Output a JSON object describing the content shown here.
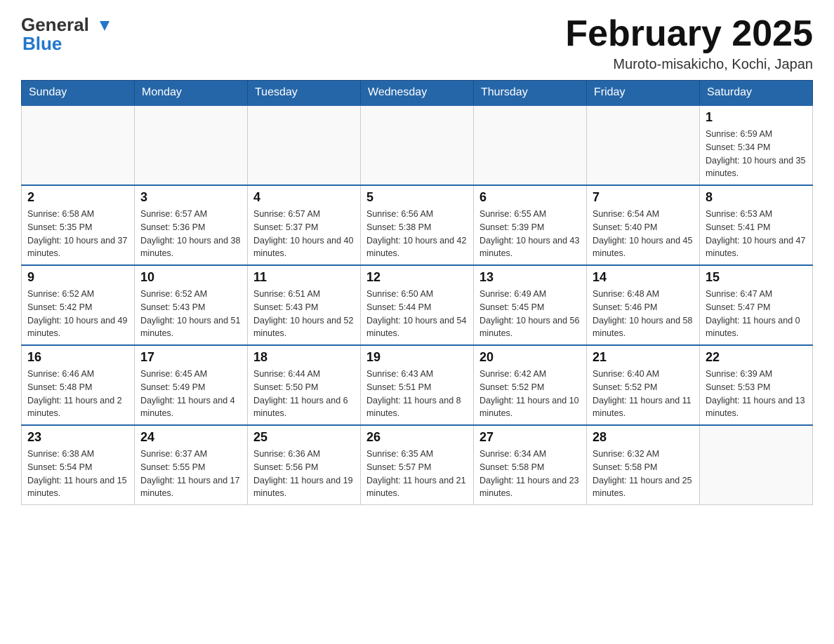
{
  "header": {
    "logo_general": "General",
    "logo_blue": "Blue",
    "month_title": "February 2025",
    "location": "Muroto-misakicho, Kochi, Japan"
  },
  "days_of_week": [
    "Sunday",
    "Monday",
    "Tuesday",
    "Wednesday",
    "Thursday",
    "Friday",
    "Saturday"
  ],
  "weeks": [
    {
      "days": [
        {
          "num": "",
          "info": ""
        },
        {
          "num": "",
          "info": ""
        },
        {
          "num": "",
          "info": ""
        },
        {
          "num": "",
          "info": ""
        },
        {
          "num": "",
          "info": ""
        },
        {
          "num": "",
          "info": ""
        },
        {
          "num": "1",
          "info": "Sunrise: 6:59 AM\nSunset: 5:34 PM\nDaylight: 10 hours and 35 minutes."
        }
      ]
    },
    {
      "days": [
        {
          "num": "2",
          "info": "Sunrise: 6:58 AM\nSunset: 5:35 PM\nDaylight: 10 hours and 37 minutes."
        },
        {
          "num": "3",
          "info": "Sunrise: 6:57 AM\nSunset: 5:36 PM\nDaylight: 10 hours and 38 minutes."
        },
        {
          "num": "4",
          "info": "Sunrise: 6:57 AM\nSunset: 5:37 PM\nDaylight: 10 hours and 40 minutes."
        },
        {
          "num": "5",
          "info": "Sunrise: 6:56 AM\nSunset: 5:38 PM\nDaylight: 10 hours and 42 minutes."
        },
        {
          "num": "6",
          "info": "Sunrise: 6:55 AM\nSunset: 5:39 PM\nDaylight: 10 hours and 43 minutes."
        },
        {
          "num": "7",
          "info": "Sunrise: 6:54 AM\nSunset: 5:40 PM\nDaylight: 10 hours and 45 minutes."
        },
        {
          "num": "8",
          "info": "Sunrise: 6:53 AM\nSunset: 5:41 PM\nDaylight: 10 hours and 47 minutes."
        }
      ]
    },
    {
      "days": [
        {
          "num": "9",
          "info": "Sunrise: 6:52 AM\nSunset: 5:42 PM\nDaylight: 10 hours and 49 minutes."
        },
        {
          "num": "10",
          "info": "Sunrise: 6:52 AM\nSunset: 5:43 PM\nDaylight: 10 hours and 51 minutes."
        },
        {
          "num": "11",
          "info": "Sunrise: 6:51 AM\nSunset: 5:43 PM\nDaylight: 10 hours and 52 minutes."
        },
        {
          "num": "12",
          "info": "Sunrise: 6:50 AM\nSunset: 5:44 PM\nDaylight: 10 hours and 54 minutes."
        },
        {
          "num": "13",
          "info": "Sunrise: 6:49 AM\nSunset: 5:45 PM\nDaylight: 10 hours and 56 minutes."
        },
        {
          "num": "14",
          "info": "Sunrise: 6:48 AM\nSunset: 5:46 PM\nDaylight: 10 hours and 58 minutes."
        },
        {
          "num": "15",
          "info": "Sunrise: 6:47 AM\nSunset: 5:47 PM\nDaylight: 11 hours and 0 minutes."
        }
      ]
    },
    {
      "days": [
        {
          "num": "16",
          "info": "Sunrise: 6:46 AM\nSunset: 5:48 PM\nDaylight: 11 hours and 2 minutes."
        },
        {
          "num": "17",
          "info": "Sunrise: 6:45 AM\nSunset: 5:49 PM\nDaylight: 11 hours and 4 minutes."
        },
        {
          "num": "18",
          "info": "Sunrise: 6:44 AM\nSunset: 5:50 PM\nDaylight: 11 hours and 6 minutes."
        },
        {
          "num": "19",
          "info": "Sunrise: 6:43 AM\nSunset: 5:51 PM\nDaylight: 11 hours and 8 minutes."
        },
        {
          "num": "20",
          "info": "Sunrise: 6:42 AM\nSunset: 5:52 PM\nDaylight: 11 hours and 10 minutes."
        },
        {
          "num": "21",
          "info": "Sunrise: 6:40 AM\nSunset: 5:52 PM\nDaylight: 11 hours and 11 minutes."
        },
        {
          "num": "22",
          "info": "Sunrise: 6:39 AM\nSunset: 5:53 PM\nDaylight: 11 hours and 13 minutes."
        }
      ]
    },
    {
      "days": [
        {
          "num": "23",
          "info": "Sunrise: 6:38 AM\nSunset: 5:54 PM\nDaylight: 11 hours and 15 minutes."
        },
        {
          "num": "24",
          "info": "Sunrise: 6:37 AM\nSunset: 5:55 PM\nDaylight: 11 hours and 17 minutes."
        },
        {
          "num": "25",
          "info": "Sunrise: 6:36 AM\nSunset: 5:56 PM\nDaylight: 11 hours and 19 minutes."
        },
        {
          "num": "26",
          "info": "Sunrise: 6:35 AM\nSunset: 5:57 PM\nDaylight: 11 hours and 21 minutes."
        },
        {
          "num": "27",
          "info": "Sunrise: 6:34 AM\nSunset: 5:58 PM\nDaylight: 11 hours and 23 minutes."
        },
        {
          "num": "28",
          "info": "Sunrise: 6:32 AM\nSunset: 5:58 PM\nDaylight: 11 hours and 25 minutes."
        },
        {
          "num": "",
          "info": ""
        }
      ]
    }
  ]
}
